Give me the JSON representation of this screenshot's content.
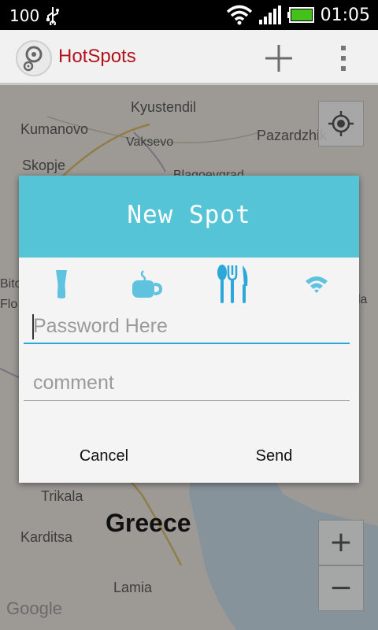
{
  "status_bar": {
    "battery_level": "100",
    "time": "01:05"
  },
  "action_bar": {
    "title": "HotSpots",
    "title_color": "#b2121a"
  },
  "map": {
    "labels": {
      "kyustendil": "Kyustendil",
      "kumanovo": "Kumanovo",
      "vaksevo": "Vaksevo",
      "pazardzhik": "Pazardzhik",
      "skopje": "Skopje",
      "blagoevgrad": "Blagoevgrad",
      "bito": "Bito",
      "la": "la",
      "flo": "Flo",
      "trikala": "Trikala",
      "greece": "Greece",
      "karditsa": "Karditsa",
      "lamia": "Lamia"
    },
    "attribution": "Google",
    "zoom_in": "+",
    "zoom_out": "−"
  },
  "dialog": {
    "title": "New Spot",
    "header_color": "#55c4d6",
    "categories": [
      {
        "name": "bar",
        "icon": "beer-glass-icon"
      },
      {
        "name": "cafe",
        "icon": "coffee-cup-icon"
      },
      {
        "name": "restaurant",
        "icon": "cutlery-icon",
        "selected": true
      },
      {
        "name": "wifi",
        "icon": "wifi-icon"
      }
    ],
    "password_placeholder": "Password Here",
    "comment_placeholder": "comment",
    "cancel_label": "Cancel",
    "send_label": "Send"
  }
}
